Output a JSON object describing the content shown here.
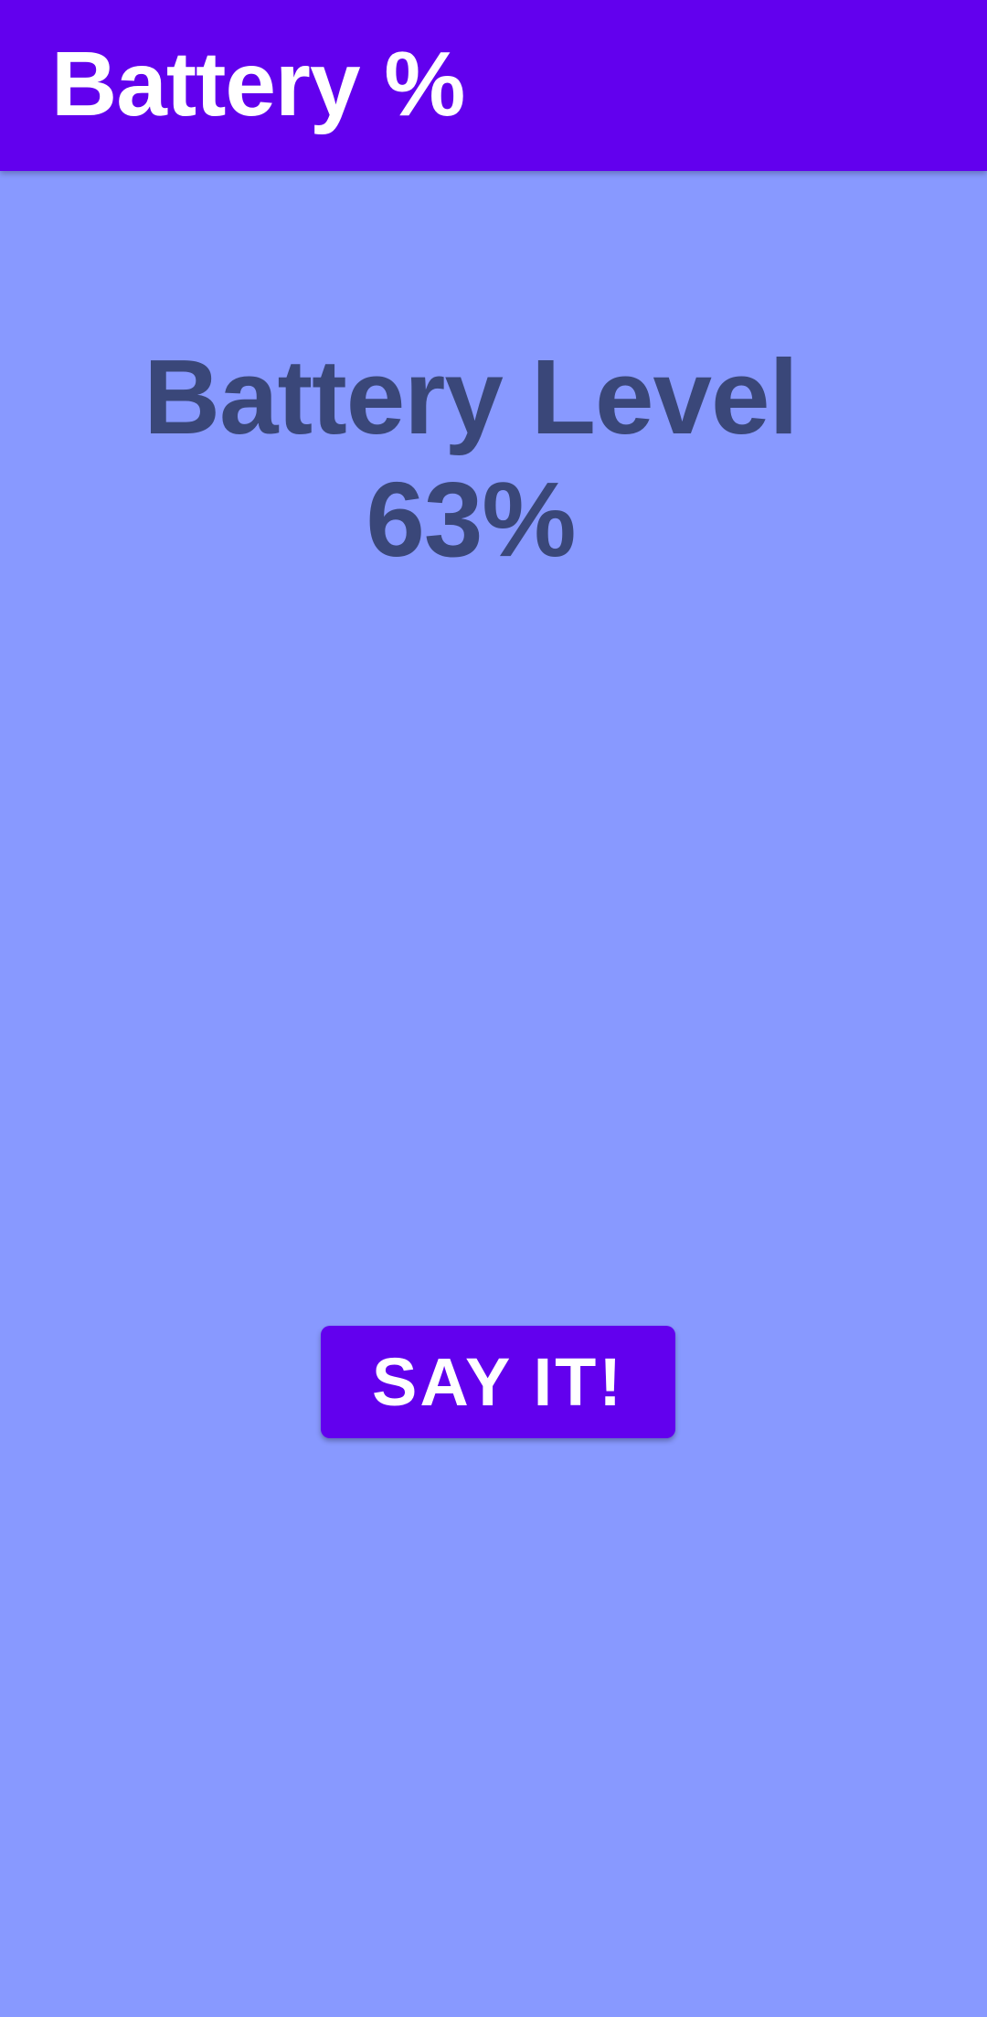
{
  "app_bar": {
    "title": "Battery %"
  },
  "main": {
    "heading": "Battery Level",
    "level_text": "63%",
    "level_percent": 63,
    "action_button_label": "SAY IT!"
  },
  "colors": {
    "app_bar_background": "#6200EE",
    "page_background": "#8899FF",
    "heading_text": "#3A4779",
    "button_background": "#6200EE",
    "button_text": "#FFFFFF"
  }
}
